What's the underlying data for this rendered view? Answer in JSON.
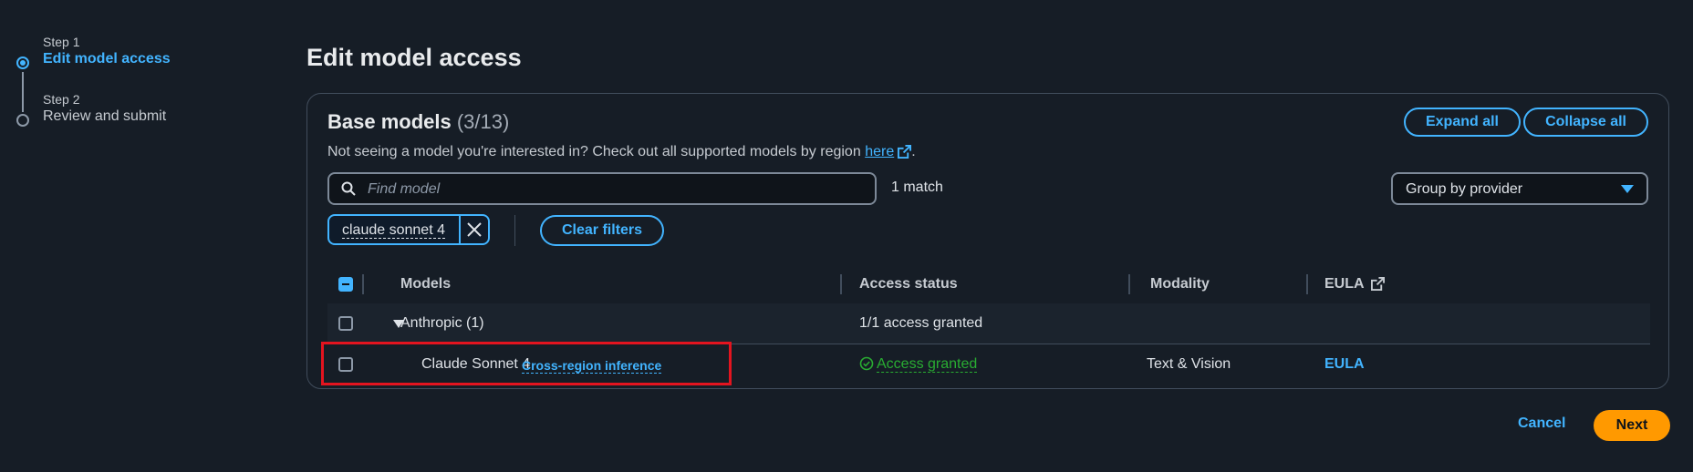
{
  "stepper": {
    "steps": [
      {
        "sublabel": "Step 1",
        "label": "Edit model access",
        "active": true
      },
      {
        "sublabel": "Step 2",
        "label": "Review and submit",
        "active": false
      }
    ]
  },
  "page": {
    "title": "Edit model access"
  },
  "container": {
    "title": "Base models",
    "count": "(3/13)",
    "description_prefix": "Not seeing a model you're interested in? Check out all supported models by region",
    "description_link": "here",
    "description_suffix": ".",
    "expand_all": "Expand all",
    "collapse_all": "Collapse all"
  },
  "search": {
    "placeholder": "Find model",
    "match_text": "1 match"
  },
  "group_select": {
    "value": "Group by provider"
  },
  "filter_token": {
    "text": "claude sonnet 4"
  },
  "clear_filters": "Clear filters",
  "table": {
    "columns": [
      "Models",
      "Access status",
      "Modality",
      "EULA"
    ],
    "group": {
      "name": "Anthropic (1)",
      "access_status": "1/1 access granted"
    },
    "rows": [
      {
        "model": "Claude Sonnet 4",
        "badge": "Cross-region inference",
        "access_status": "Access granted",
        "modality": "Text & Vision",
        "eula": "EULA"
      }
    ]
  },
  "footer": {
    "cancel": "Cancel",
    "next": "Next"
  },
  "colors": {
    "accent": "#42b4ff",
    "primary_button": "#ff9900",
    "success": "#29ad32",
    "highlight": "#e3141f",
    "background": "#161d26"
  },
  "icons": [
    "search-icon",
    "external-link-icon",
    "close-icon",
    "caret-down-icon",
    "check-circle-icon",
    "expand-triangle-icon"
  ]
}
